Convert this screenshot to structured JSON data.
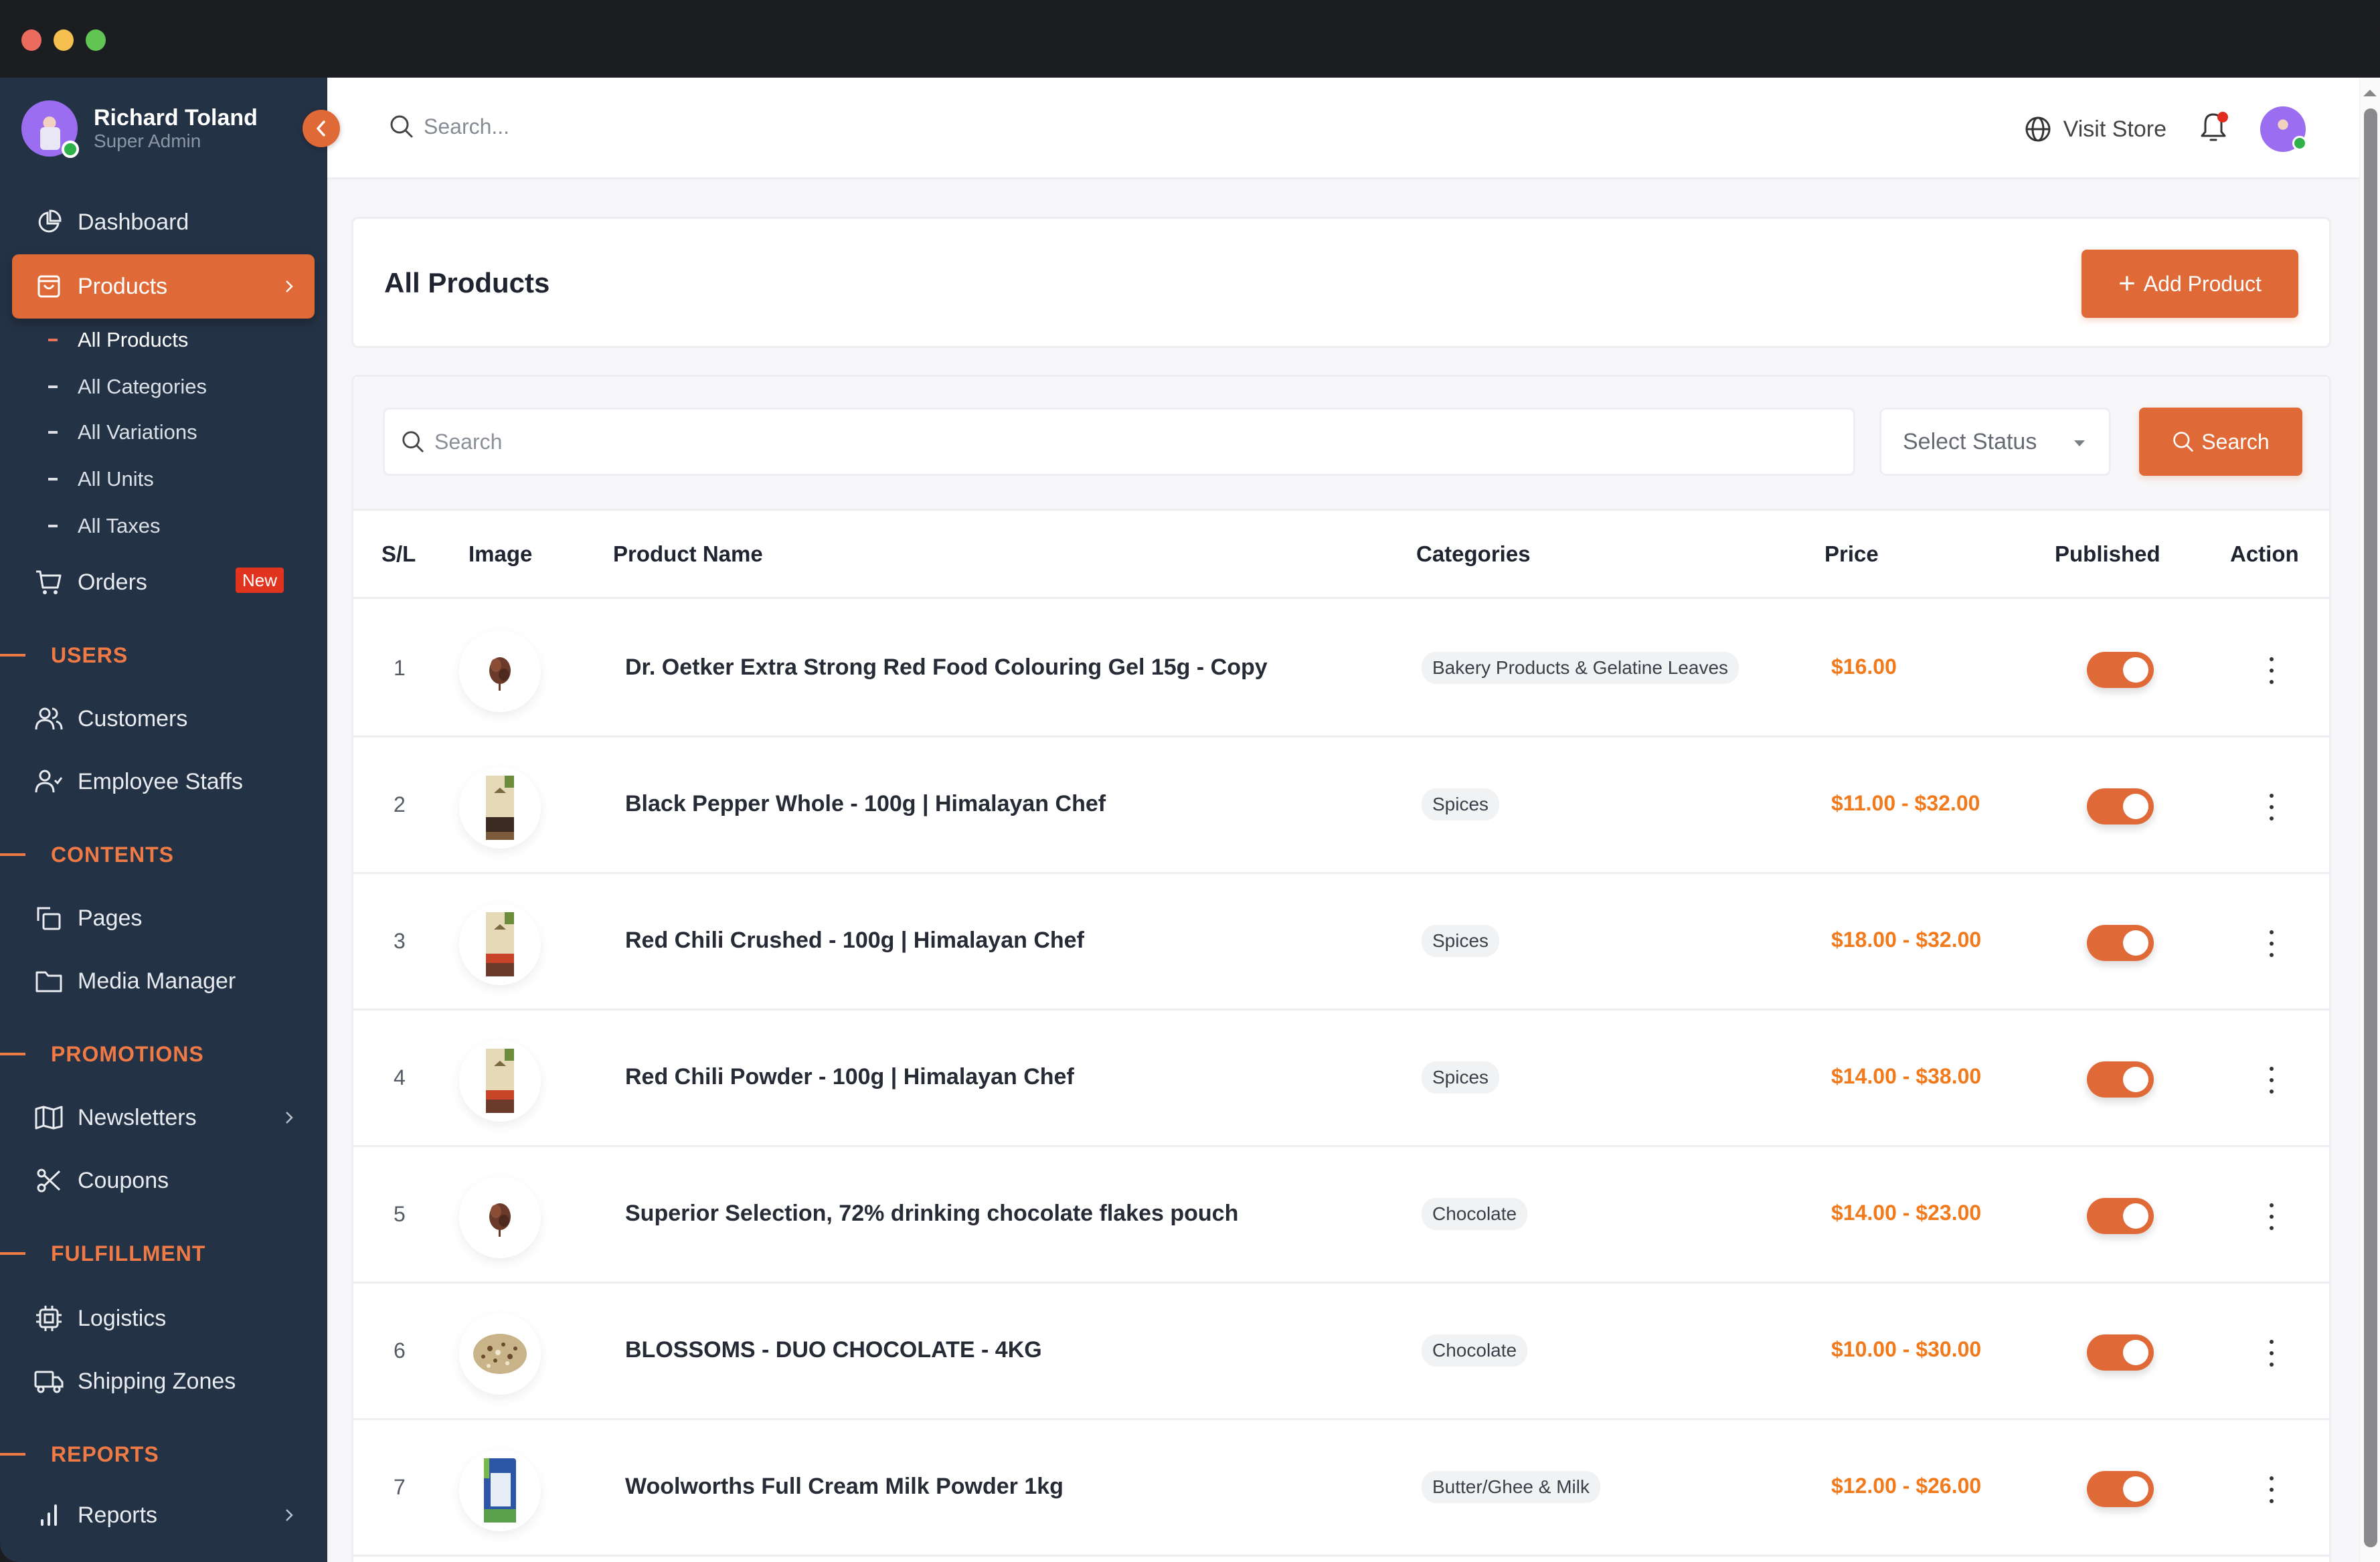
{
  "window": {
    "controls": [
      "close",
      "minimize",
      "maximize"
    ]
  },
  "user": {
    "name": "Richard Toland",
    "role": "Super Admin",
    "status": "online"
  },
  "sidebar": {
    "items": [
      {
        "label": "Dashboard",
        "icon": "pie-chart-icon"
      },
      {
        "label": "Products",
        "icon": "shopping-bag-icon",
        "active": true,
        "expanded": true,
        "children": [
          {
            "label": "All Products",
            "active": true
          },
          {
            "label": "All Categories"
          },
          {
            "label": "All Variations"
          },
          {
            "label": "All Units"
          },
          {
            "label": "All Taxes"
          }
        ]
      },
      {
        "label": "Orders",
        "icon": "cart-icon",
        "badge": "New"
      }
    ],
    "sections": [
      {
        "title": "USERS",
        "items": [
          {
            "label": "Customers",
            "icon": "users-icon"
          },
          {
            "label": "Employee Staffs",
            "icon": "user-check-icon"
          }
        ]
      },
      {
        "title": "CONTENTS",
        "items": [
          {
            "label": "Pages",
            "icon": "pages-icon"
          },
          {
            "label": "Media Manager",
            "icon": "folder-icon"
          }
        ]
      },
      {
        "title": "PROMOTIONS",
        "items": [
          {
            "label": "Newsletters",
            "icon": "map-icon",
            "has_submenu": true
          },
          {
            "label": "Coupons",
            "icon": "scissors-icon"
          }
        ]
      },
      {
        "title": "FULFILLMENT",
        "items": [
          {
            "label": "Logistics",
            "icon": "chip-icon"
          },
          {
            "label": "Shipping Zones",
            "icon": "truck-icon"
          }
        ]
      },
      {
        "title": "REPORTS",
        "items": [
          {
            "label": "Reports",
            "icon": "bar-chart-icon",
            "has_submenu": true
          }
        ]
      }
    ]
  },
  "topbar": {
    "search_placeholder": "Search...",
    "visit_store_label": "Visit Store",
    "notifications_unread": true
  },
  "page": {
    "title": "All Products",
    "add_button_label": "Add Product"
  },
  "filters": {
    "search_placeholder": "Search",
    "status_select_value": "Select Status",
    "search_button_label": "Search"
  },
  "table": {
    "columns": [
      "S/L",
      "Image",
      "Product Name",
      "Categories",
      "Price",
      "Published",
      "Action"
    ],
    "rows": [
      {
        "sl": "1",
        "name": "Dr. Oetker Extra Strong Red Food Colouring Gel 15g - Copy",
        "category": "Bakery Products & Gelatine Leaves",
        "price": "$16.00",
        "published": true,
        "image": "chocolate-flakes"
      },
      {
        "sl": "2",
        "name": "Black Pepper Whole - 100g | Himalayan Chef",
        "category": "Spices",
        "price": "$11.00 - $32.00",
        "published": true,
        "image": "spice-pack-dark"
      },
      {
        "sl": "3",
        "name": "Red Chili Crushed - 100g | Himalayan Chef",
        "category": "Spices",
        "price": "$18.00 - $32.00",
        "published": true,
        "image": "spice-pack-red"
      },
      {
        "sl": "4",
        "name": "Red Chili Powder - 100g | Himalayan Chef",
        "category": "Spices",
        "price": "$14.00 - $38.00",
        "published": true,
        "image": "spice-pack-red"
      },
      {
        "sl": "5",
        "name": "Superior Selection, 72% drinking chocolate flakes pouch",
        "category": "Chocolate",
        "price": "$14.00 - $23.00",
        "published": true,
        "image": "chocolate-flakes"
      },
      {
        "sl": "6",
        "name": "BLOSSOMS - DUO CHOCOLATE - 4KG",
        "category": "Chocolate",
        "price": "$10.00 - $30.00",
        "published": true,
        "image": "blossoms"
      },
      {
        "sl": "7",
        "name": "Woolworths Full Cream Milk Powder 1kg",
        "category": "Butter/Ghee & Milk",
        "price": "$12.00 - $26.00",
        "published": true,
        "image": "milk-powder-bag"
      }
    ]
  },
  "colors": {
    "accent": "#e06a37",
    "sidebar_bg": "#243245",
    "section_title": "#ef7a45",
    "price": "#f07a1c",
    "badge_new": "#e1341e"
  }
}
